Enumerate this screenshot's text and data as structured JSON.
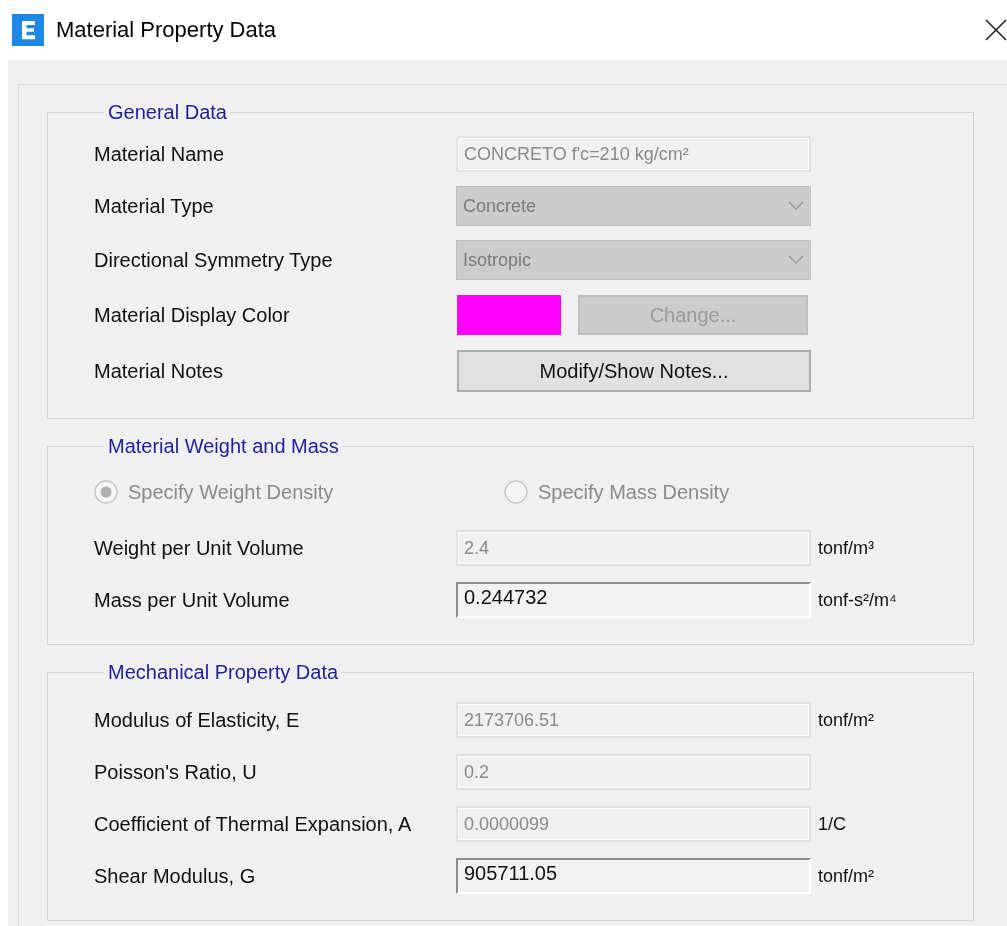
{
  "window": {
    "title": "Material Property Data"
  },
  "general": {
    "title": "General Data",
    "rows": [
      {
        "label": "Material Name",
        "kind": "text",
        "value": "CONCRETO f'c=210 kg/cm²",
        "disabled": true
      },
      {
        "label": "Material Type",
        "kind": "dropdown",
        "value": "Concrete",
        "disabled": true
      },
      {
        "label": "Directional Symmetry Type",
        "kind": "dropdown",
        "value": "Isotropic",
        "disabled": true
      },
      {
        "label": "Material Display Color",
        "kind": "color",
        "color": "#ff00ff",
        "button": "Change...",
        "disabled": true
      },
      {
        "label": "Material Notes",
        "kind": "button",
        "button": "Modify/Show Notes...",
        "disabled": false
      }
    ]
  },
  "weight": {
    "title": "Material Weight and Mass",
    "radios": [
      {
        "label": "Specify Weight Density",
        "selected": true,
        "disabled": true
      },
      {
        "label": "Specify Mass Density",
        "selected": false,
        "disabled": true
      }
    ],
    "fields": [
      {
        "label": "Weight per Unit Volume",
        "value": "2.4",
        "unit": "tonf/m³",
        "disabled": true
      },
      {
        "label": "Mass per Unit Volume",
        "value": "0.244732",
        "unit": "tonf-s²/m⁴",
        "disabled": false
      }
    ]
  },
  "mechanical": {
    "title": "Mechanical Property Data",
    "fields": [
      {
        "label": "Modulus of Elasticity,  E",
        "value": "2173706.51",
        "unit": "tonf/m²",
        "disabled": true
      },
      {
        "label": "Poisson's Ratio,  U",
        "value": "0.2",
        "disabled": true
      },
      {
        "label": "Coefficient of Thermal Expansion,  A",
        "value": "0.0000099",
        "unit": "1/C",
        "disabled": true
      },
      {
        "label": "Shear Modulus,  G",
        "value": "905711.05",
        "unit": "tonf/m²",
        "disabled": false
      }
    ]
  }
}
